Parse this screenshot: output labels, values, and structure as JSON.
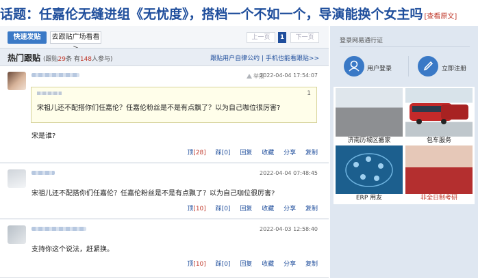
{
  "topic": {
    "title": "话题：任嘉伦无缝进组《无忧度》，搭档一个不如一个，导演能换个女主吗",
    "link": "[查看原文]"
  },
  "toolbar": {
    "post_label": "快速发贴",
    "square_label": "去跟贴广场看看 >",
    "prev_label": "上一页",
    "page_num": "1",
    "next_label": "下一页"
  },
  "hot": {
    "title": "热门跟贴",
    "meta_prefix": "(跟贴",
    "post_count": "29",
    "meta_mid": "条 有",
    "people_count": "148",
    "meta_suffix": "人参与)",
    "links": "跟贴用户自律公约 | 手机也能看跟贴>>"
  },
  "posts": [
    {
      "report_label": "举报",
      "time": "2022-04-04 17:54:07",
      "quote_floor": "1",
      "quote_text": "宋祖儿还不配搭你们任嘉伦？任嘉伦粉丝是不是有点飘了？以为自己咖位很厉害?",
      "text": "宋是谁?",
      "up": "顶",
      "up_count": "[28]",
      "down": "踩",
      "down_count": "[0]",
      "reply": "回复",
      "favorite": "收藏",
      "share": "分享",
      "copy": "复制"
    },
    {
      "time": "2022-04-04 07:48:45",
      "text": "宋祖儿还不配搭你们任嘉伦？任嘉伦粉丝是不是有点飘了？以为自己咖位很厉害?",
      "up": "顶",
      "up_count": "[10]",
      "down": "踩",
      "down_count": "[0]",
      "reply": "回复",
      "favorite": "收藏",
      "share": "分享",
      "copy": "复制"
    },
    {
      "time": "2022-04-03 12:58:40",
      "text": "支持你这个说法，赶紧换。",
      "up": "顶",
      "up_count": "[10]",
      "down": "踩",
      "down_count": "[0]",
      "reply": "回复",
      "favorite": "收藏",
      "share": "分享",
      "copy": "复制"
    }
  ],
  "side": {
    "title": "登录网易通行证",
    "login_label": "用户登录",
    "register_label": "立即注册",
    "login_icon": "user-icon",
    "register_icon": "pencil-icon"
  },
  "ads": [
    {
      "label": "济南历城区搬家"
    },
    {
      "label": "包车服务"
    },
    {
      "label": "ERP 用友"
    },
    {
      "label": "非全日制考研"
    }
  ],
  "colors": {
    "brand_blue": "#1f4e9c",
    "button_blue": "#3a79c6",
    "highlight_red": "#c0392b",
    "quote_bg": "#fffeea"
  }
}
